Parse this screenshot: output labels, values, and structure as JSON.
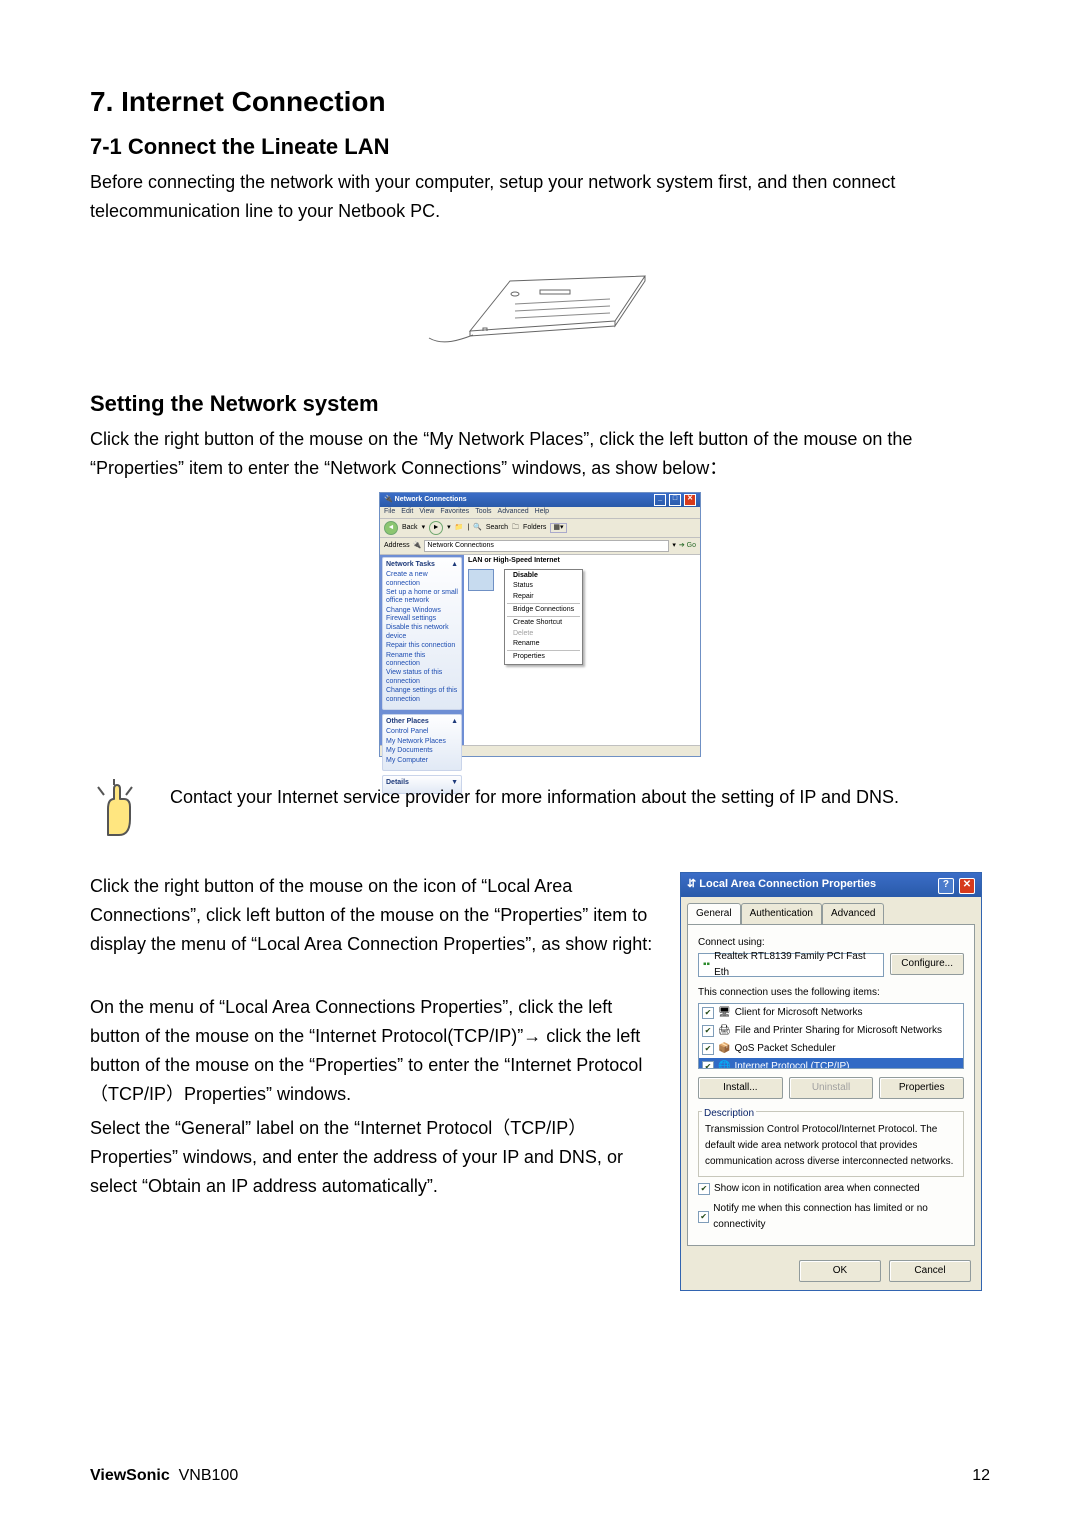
{
  "section_number": "7.",
  "section_title": "Internet Connection",
  "subsection_1": "7-1 Connect the Lineate LAN",
  "para_intro": "Before connecting the network with your computer, setup your network system first, and then connect telecommunication line to your Netbook PC.",
  "subsection_2": "Setting the Network system",
  "para_setting": "Click the right button of the mouse on the “My Network Places”, click the left button of the mouse on the “Properties” item to enter the “Network Connections” windows, as show below：",
  "note_text": "Contact your Internet service provider for more information about the setting of IP and DNS.",
  "para_lac1": "Click the right button of the mouse on the icon of “Local Area Connections”, click left button of the mouse on the “Properties” item to display the menu of “Local Area Connection Properties”, as show right:",
  "para_lac2": "On the menu of “Local Area Connections Properties”, click the left button of the mouse on the “Internet Protocol(TCP/IP)”→ click the left button of the mouse on the “Properties” to enter the “Internet Protocol（TCP/IP）Properties” windows.",
  "para_lac3": "Select the “General” label on the “Internet Protocol（TCP/IP）Properties” windows, and enter the address of your IP and DNS, or select “Obtain an IP address automatically”.",
  "footer_brand": "ViewSonic",
  "footer_model": "VNB100",
  "footer_page": "12",
  "nc": {
    "title": "Network Connections",
    "menu": [
      "File",
      "Edit",
      "View",
      "Favorites",
      "Tools",
      "Advanced",
      "Help"
    ],
    "toolbar": {
      "back": "Back",
      "search": "Search",
      "folders": "Folders"
    },
    "address_label": "Address",
    "address_value": "Network Connections",
    "go": "Go",
    "section_label": "LAN or High-Speed Internet",
    "tasks_title": "Network Tasks",
    "tasks": [
      "Create a new connection",
      "Set up a home or small office network",
      "Change Windows Firewall settings",
      "Disable this network device",
      "Repair this connection",
      "Rename this connection",
      "View status of this connection",
      "Change settings of this connection"
    ],
    "other_title": "Other Places",
    "other": [
      "Control Panel",
      "My Network Places",
      "My Documents",
      "My Computer"
    ],
    "details_title": "Details",
    "context": [
      "Disable",
      "Status",
      "Repair",
      "sep",
      "Bridge Connections",
      "sep",
      "Create Shortcut",
      "Delete",
      "Rename",
      "sep",
      "Properties"
    ]
  },
  "dlg": {
    "title": "Local Area Connection Properties",
    "tabs": [
      "General",
      "Authentication",
      "Advanced"
    ],
    "connect_using_label": "Connect using:",
    "adapter": "Realtek RTL8139 Family PCI Fast Eth",
    "configure": "Configure...",
    "items_label": "This connection uses the following items:",
    "items": [
      "Client for Microsoft Networks",
      "File and Printer Sharing for Microsoft Networks",
      "QoS Packet Scheduler",
      "Internet Protocol (TCP/IP)"
    ],
    "install": "Install...",
    "uninstall": "Uninstall",
    "properties": "Properties",
    "description_label": "Description",
    "description": "Transmission Control Protocol/Internet Protocol. The default wide area network protocol that provides communication across diverse interconnected networks.",
    "show_icon": "Show icon in notification area when connected",
    "notify": "Notify me when this connection has limited or no connectivity",
    "ok": "OK",
    "cancel": "Cancel"
  }
}
